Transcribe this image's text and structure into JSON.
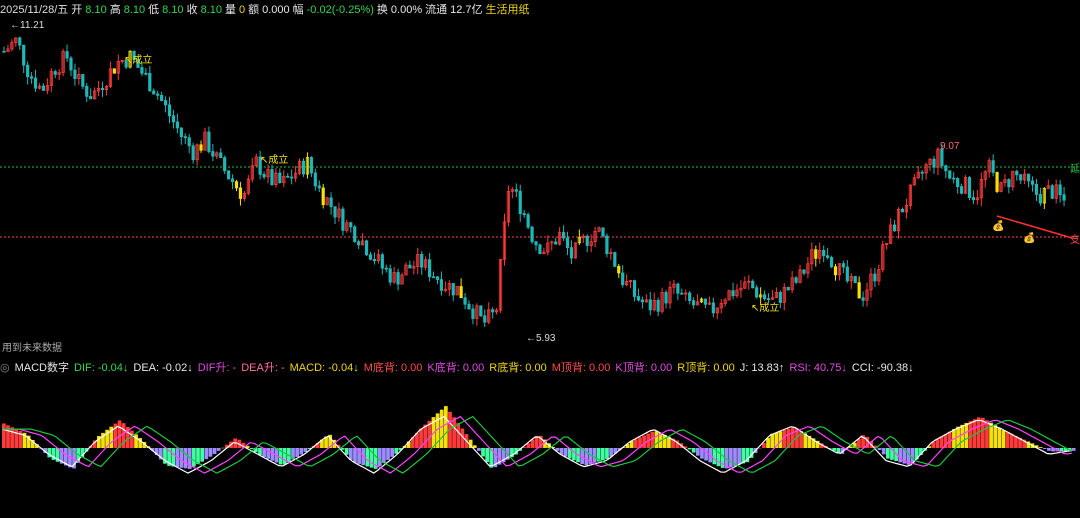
{
  "info": {
    "date": "2025/11/28/五",
    "open_label": "开",
    "open": "8.10",
    "high_label": "高",
    "high": "8.10",
    "low_label": "低",
    "low": "8.10",
    "close_label": "收",
    "close": "8.10",
    "vol_label": "量",
    "vol": "0",
    "amount_label": "额",
    "amount": "0.000",
    "change_label": "幅",
    "change": "-0.02(-0.25%)",
    "turnover_label": "换",
    "turnover": "0.00%",
    "float_label": "流通",
    "float": "12.7亿",
    "sector": "生活用纸"
  },
  "price_labels": {
    "high_mark": "11.21",
    "low_mark": "5.93",
    "recent_high": "9.07",
    "signal_1": "成立",
    "signal_2": "成立",
    "signal_3": "成立",
    "right_green": "延",
    "right_red": "支"
  },
  "future_note": "用到未来数据",
  "indicator": {
    "name": "MACD数字",
    "dif": "DIF: -0.04↓",
    "dea": "DEA: -0.02↓",
    "dif_up": "DIF升: -",
    "dea_up": "DEA升: -",
    "macd": "MACD: -0.04↓",
    "m_bottom": "M底背: 0.00",
    "k_bottom": "K底背: 0.00",
    "r_bottom": "R底背: 0.00",
    "m_top": "M顶背: 0.00",
    "k_top": "K顶背: 0.00",
    "r_top": "R顶背: 0.00",
    "j": "J: 13.83↑",
    "rsi": "RSI: 40.75↓",
    "cci": "CCI: -90.38↓"
  },
  "colors": {
    "up": "#ff3b3b",
    "down": "#1fb7b7",
    "yellow": "#f5e10a",
    "green_line": "#19c83c",
    "red_line": "#ff4a4a",
    "dif": "#ffffff",
    "dea": "#ff43ff",
    "macd_pos": "#ff3b3b",
    "macd_neg": "#9b8cff",
    "macd_neg2": "#3fffa0"
  },
  "chart_data": {
    "type": "candlestick",
    "price_high": 11.21,
    "price_low": 5.93,
    "recent_high": 9.07,
    "resistance": 9.07,
    "support": 8.1,
    "close_path": [
      10.9,
      11.1,
      10.5,
      10.2,
      10.6,
      10.8,
      10.3,
      10.1,
      10.4,
      10.7,
      10.8,
      10.5,
      10.2,
      9.8,
      9.4,
      9.1,
      9.3,
      8.9,
      8.6,
      8.3,
      8.9,
      8.6,
      8.5,
      8.7,
      8.9,
      8.4,
      8.1,
      7.8,
      7.6,
      7.3,
      7.0,
      6.8,
      7.0,
      7.1,
      6.9,
      6.7,
      6.6,
      6.3,
      6.0,
      6.2,
      8.5,
      8.1,
      7.5,
      7.3,
      7.6,
      7.2,
      7.5,
      7.7,
      7.3,
      6.8,
      6.5,
      6.3,
      6.4,
      6.6,
      6.4,
      6.3,
      6.2,
      6.5,
      6.6,
      6.7,
      6.5,
      6.4,
      6.6,
      6.8,
      7.2,
      7.4,
      7.0,
      6.7,
      6.5,
      6.9,
      7.5,
      8.0,
      8.4,
      8.8,
      9.0,
      8.6,
      8.5,
      8.3,
      8.8,
      8.4,
      8.7,
      8.5,
      8.3,
      8.4,
      8.2
    ],
    "ind_dif": [
      0.3,
      0.2,
      -0.1,
      -0.3,
      0.1,
      0.35,
      0.1,
      -0.2,
      -0.4,
      -0.2,
      0.1,
      -0.1,
      -0.3,
      -0.1,
      0.2,
      -0.2,
      -0.4,
      -0.1,
      0.3,
      0.5,
      0.1,
      -0.3,
      -0.1,
      0.2,
      -0.1,
      -0.3,
      -0.2,
      0.1,
      0.3,
      0.1,
      -0.2,
      -0.4,
      -0.2,
      0.2,
      0.35,
      0.1,
      -0.1,
      0.2,
      -0.2,
      -0.3,
      0.1,
      0.3,
      0.45,
      0.3,
      0.1,
      -0.1,
      -0.04
    ],
    "ind_macd": [
      0.35,
      0.2,
      -0.15,
      -0.3,
      0.15,
      0.4,
      0.1,
      -0.25,
      -0.3,
      -0.1,
      0.15,
      -0.1,
      -0.25,
      -0.05,
      0.2,
      -0.2,
      -0.3,
      -0.05,
      0.3,
      0.6,
      0.15,
      -0.3,
      -0.1,
      0.2,
      -0.1,
      -0.25,
      -0.15,
      0.1,
      0.25,
      0.1,
      -0.15,
      -0.3,
      -0.2,
      0.2,
      0.3,
      0.1,
      -0.1,
      0.2,
      -0.15,
      -0.25,
      0.1,
      0.3,
      0.45,
      0.25,
      0.1,
      -0.05,
      -0.04
    ]
  }
}
